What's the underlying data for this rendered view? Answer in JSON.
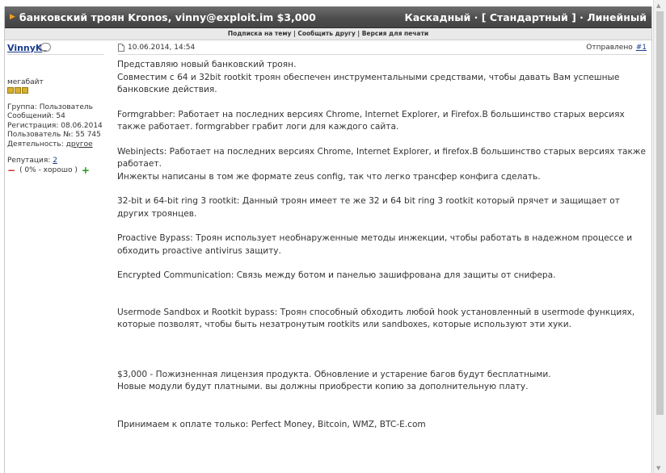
{
  "thread": {
    "title": "банковский троян Kronos, vinny@exploit.im $3,000",
    "modes": {
      "cascade": "Каскадный",
      "sep1": " · [ ",
      "standard": "Стандартный",
      "sep2": " ] · ",
      "linear": "Линейный"
    }
  },
  "subbar": {
    "subscribe": "Подписка на тему",
    "sep1": " | ",
    "tell_friend": "Сообщить другу",
    "sep2": " | ",
    "print": "Версия для печати"
  },
  "author": {
    "name": "VinnyK",
    "rank": "мегабайт",
    "stars": 3,
    "group": "Группа: Пользователь",
    "posts": "Сообщений: 54",
    "registered": "Регистрация: 08.06.2014",
    "user_no": "Пользователь №: 55 745",
    "activity_label": "Деятельность: ",
    "activity_value": "другое",
    "rep_label": "Репутация: ",
    "rep_value": "2",
    "rep_detail": "( 0% - хорошо )"
  },
  "post": {
    "date": "10.06.2014, 14:54",
    "sent_label": "Отправлено",
    "post_link": "#1",
    "paragraphs": [
      [
        "Представляю новый банковский троян.",
        "Совместим с 64 и 32bit rootkit троян обеспечен инструментальными средствами, чтобы давать Вам успешные банковские действия."
      ],
      [
        "Formgrabber: Работает на последних версиях Chrome, Internet Explorer, и Firefox.В большинство старых версиях также работает. formgrabber грабит логи для каждого сайта."
      ],
      [
        "Webinjects: Работает на последних версиях Chrome, Internet Explorer, и firefox.В большинство старых версиях также работает.",
        "Инжекты написаны в том же формате zeus config, так что легко трансфер конфига сделать."
      ],
      [
        "32-bit и 64-bit ring 3 rootkit: Данный троян имеет те же 32 и 64 bit ring 3 rootkit который прячет и защищает от других троянцев."
      ],
      [
        "Proactive Bypass: Троян использует необнаруженные методы инжекции, чтобы работать в надежном процессе и обходить proactive antivirus защиту."
      ],
      [
        "Encrypted Communication: Связь между ботом и панелью зашифрована для защиты от снифера."
      ],
      [
        "Usermode Sandbox и Rootkit bypass: Троян способный обходить любой hook установленный в usermode функциях, которые позволят, чтобы быть незатронутым rootkits или sandboxes, которые используют эти хуки."
      ],
      [
        "$3,000 - Пожизненная лицензия продукта. Обновление и устарение багов будут бесплатными.",
        "Новые модули будут платными. вы должны приобрести копию за дополнительную плату."
      ],
      [
        "Принимаем к оплате только: Perfect Money, Bitcoin, WMZ, BTC-E.com"
      ]
    ]
  },
  "colors": {
    "titlebar": "#555555",
    "link": "#1a3c8c",
    "stars": "#d6b030",
    "rep_minus": "#d02020",
    "rep_plus": "#1a9a1a"
  }
}
